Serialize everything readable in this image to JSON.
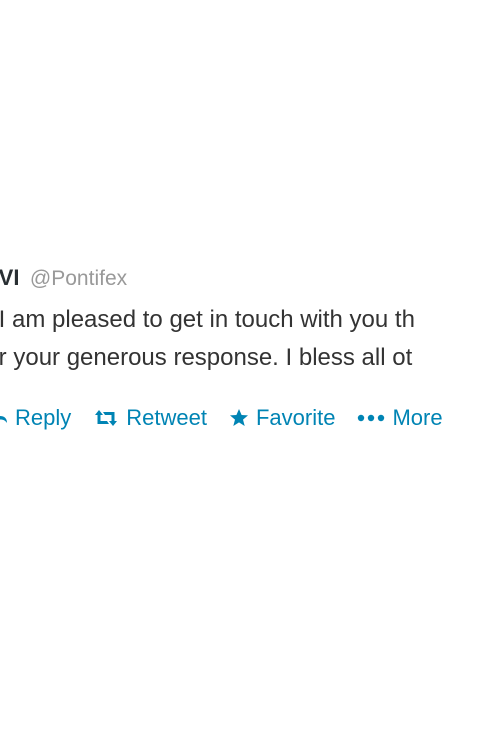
{
  "tweet": {
    "fullname": "XVI",
    "username": "@Pontifex",
    "text_lines": [
      "ds, I am pleased to get in touch with you th",
      "s for your generous response. I bless all ot"
    ]
  },
  "actions": {
    "reply": {
      "label": "Reply",
      "icon": "reply-icon"
    },
    "retweet": {
      "label": "Retweet",
      "icon": "retweet-icon"
    },
    "favorite": {
      "label": "Favorite",
      "icon": "star-icon"
    },
    "more": {
      "label": "More",
      "icon": "more-dots-icon"
    }
  },
  "colors": {
    "link": "#0084b4",
    "username": "#999999",
    "text": "#333333"
  }
}
